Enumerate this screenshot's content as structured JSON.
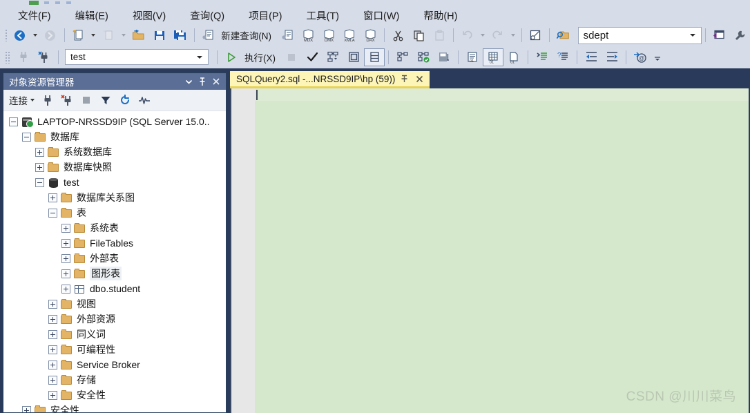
{
  "menu": {
    "items": [
      {
        "label": "文件(F)",
        "name": "menu-file"
      },
      {
        "label": "编辑(E)",
        "name": "menu-edit"
      },
      {
        "label": "视图(V)",
        "name": "menu-view"
      },
      {
        "label": "查询(Q)",
        "name": "menu-query"
      },
      {
        "label": "项目(P)",
        "name": "menu-project"
      },
      {
        "label": "工具(T)",
        "name": "menu-tools"
      },
      {
        "label": "窗口(W)",
        "name": "menu-window"
      },
      {
        "label": "帮助(H)",
        "name": "menu-help"
      }
    ]
  },
  "toolbar1": {
    "new_query_label": "新建查询(N)",
    "object_combo": {
      "value": "sdept",
      "placeholder": "sdept"
    },
    "icons": [
      "navigate-back-icon",
      "navigate-forward-icon",
      "new-project-icon",
      "new-item-icon",
      "open-file-icon",
      "save-icon",
      "save-all-icon",
      "new-query-icon",
      "new-analysis-query-icon",
      "mdx-query-icon",
      "dmx-query-icon",
      "xmla-query-icon",
      "dax-query-icon",
      "cut-icon",
      "copy-icon",
      "paste-icon",
      "undo-icon",
      "redo-icon",
      "toggle-window-icon",
      "find-object-icon",
      "vs-window-icon",
      "wrench-icon"
    ]
  },
  "toolbar2": {
    "db_combo": {
      "value": "test",
      "placeholder": "test"
    },
    "execute_label": "执行(X)",
    "icons": [
      "connect-icon",
      "connect-object-icon",
      "execute-icon",
      "stop-icon",
      "parse-icon",
      "display-estimated-plan-icon",
      "query-options-icon",
      "include-actual-plan-icon",
      "include-client-statistics-icon",
      "live-query-stats-icon",
      "results-to-text-icon",
      "results-to-grid-icon",
      "results-to-file-icon",
      "comment-icon",
      "uncomment-icon",
      "decrease-indent-icon",
      "increase-indent-icon",
      "specify-values-icon",
      "toolbar-overflow-icon"
    ]
  },
  "object_explorer": {
    "title": "对象资源管理器",
    "connect_label": "连接",
    "header_icons": [
      "chevron-down-icon",
      "pin-icon",
      "close-icon"
    ],
    "toolbar_icons": [
      "connect-plug-icon",
      "disconnect-plug-icon",
      "stop-icon",
      "filter-icon",
      "refresh-icon",
      "activity-monitor-icon"
    ],
    "tree": [
      {
        "label": "LAPTOP-NRSSD9IP (SQL Server 15.0..",
        "depth": 0,
        "state": "expanded",
        "icon": "server-icon",
        "name": "tree-node-server"
      },
      {
        "label": "数据库",
        "depth": 1,
        "state": "expanded",
        "icon": "folder-icon",
        "name": "tree-node-databases"
      },
      {
        "label": "系统数据库",
        "depth": 2,
        "state": "collapsed",
        "icon": "folder-icon",
        "name": "tree-node-system-databases"
      },
      {
        "label": "数据库快照",
        "depth": 2,
        "state": "collapsed",
        "icon": "folder-icon",
        "name": "tree-node-database-snapshots"
      },
      {
        "label": "test",
        "depth": 2,
        "state": "expanded",
        "icon": "database-icon",
        "name": "tree-node-test"
      },
      {
        "label": "数据库关系图",
        "depth": 3,
        "state": "collapsed",
        "icon": "folder-icon",
        "name": "tree-node-database-diagrams"
      },
      {
        "label": "表",
        "depth": 3,
        "state": "expanded",
        "icon": "folder-icon",
        "name": "tree-node-tables"
      },
      {
        "label": "系统表",
        "depth": 4,
        "state": "collapsed",
        "icon": "folder-icon",
        "name": "tree-node-system-tables"
      },
      {
        "label": "FileTables",
        "depth": 4,
        "state": "collapsed",
        "icon": "folder-icon",
        "name": "tree-node-filetables"
      },
      {
        "label": "外部表",
        "depth": 4,
        "state": "collapsed",
        "icon": "folder-icon",
        "name": "tree-node-external-tables"
      },
      {
        "label": "图形表",
        "depth": 4,
        "state": "collapsed",
        "icon": "folder-icon",
        "name": "tree-node-graph-tables",
        "highlighted": true
      },
      {
        "label": "dbo.student",
        "depth": 4,
        "state": "collapsed",
        "icon": "table-icon",
        "name": "tree-node-dbo-student"
      },
      {
        "label": "视图",
        "depth": 3,
        "state": "collapsed",
        "icon": "folder-icon",
        "name": "tree-node-views"
      },
      {
        "label": "外部资源",
        "depth": 3,
        "state": "collapsed",
        "icon": "folder-icon",
        "name": "tree-node-external-resources"
      },
      {
        "label": "同义词",
        "depth": 3,
        "state": "collapsed",
        "icon": "folder-icon",
        "name": "tree-node-synonyms"
      },
      {
        "label": "可编程性",
        "depth": 3,
        "state": "collapsed",
        "icon": "folder-icon",
        "name": "tree-node-programmability"
      },
      {
        "label": "Service Broker",
        "depth": 3,
        "state": "collapsed",
        "icon": "folder-icon",
        "name": "tree-node-service-broker"
      },
      {
        "label": "存储",
        "depth": 3,
        "state": "collapsed",
        "icon": "folder-icon",
        "name": "tree-node-storage"
      },
      {
        "label": "安全性",
        "depth": 3,
        "state": "collapsed",
        "icon": "folder-icon",
        "name": "tree-node-security-db"
      },
      {
        "label": "安全性",
        "depth": 1,
        "state": "collapsed",
        "icon": "folder-icon",
        "name": "tree-node-security-server"
      }
    ]
  },
  "document": {
    "tab": {
      "title": "SQLQuery2.sql -...NRSSD9IP\\hp (59))",
      "pin_icon": "pin-icon",
      "close_icon": "close-icon"
    },
    "editor": {
      "content": "",
      "watermark": "CSDN @川川菜鸟"
    }
  },
  "colors": {
    "chrome": "#d6dce8",
    "workspace": "#293a5a",
    "panel_header": "#5a6e96",
    "tab_active": "#fdf5b8",
    "tab_underline": "#e8d154",
    "editor_bg": "#d5e8cc",
    "folder": "#e3b465",
    "execute_green": "#3a9b35"
  }
}
